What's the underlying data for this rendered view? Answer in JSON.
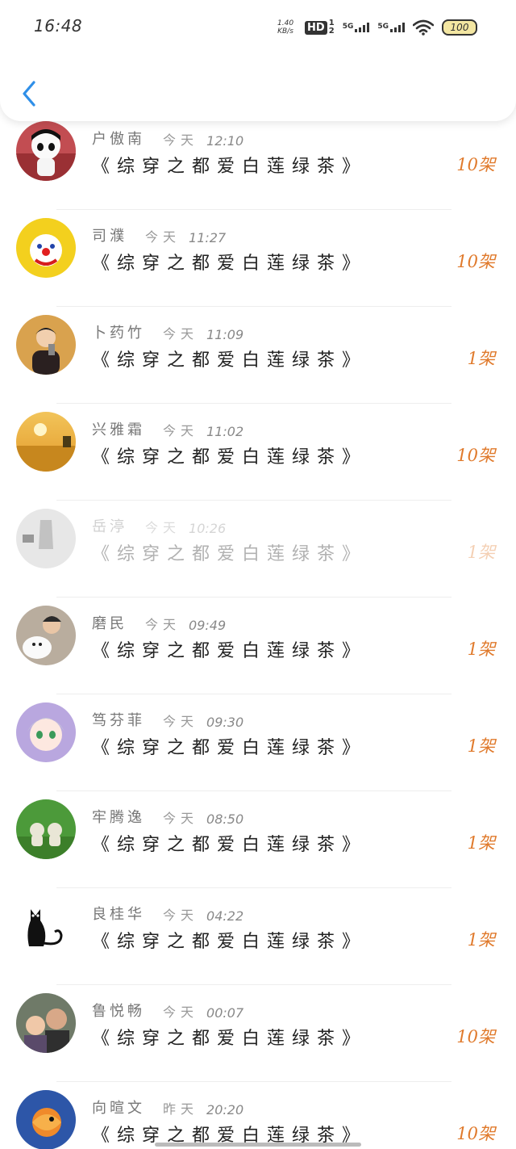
{
  "status_bar": {
    "time": "16:48",
    "net_speed_value": "1.40",
    "net_speed_unit": "KB/s",
    "hd_label": "HD",
    "hd_sub_top": "1",
    "hd_sub_bottom": "2",
    "signal_1": "5G",
    "signal_2": "5G",
    "battery": "100"
  },
  "header": {
    "back_icon": "chevron-left-icon",
    "accent": "#2f8fe8"
  },
  "colors": {
    "gift_orange": "#e07a2c"
  },
  "items": [
    {
      "name": "户傲南",
      "day": "今天",
      "time": "12:10",
      "title": "《综穿之都爱白莲绿茶》",
      "gift": "10架",
      "faded": false
    },
    {
      "name": "司濮",
      "day": "今天",
      "time": "11:27",
      "title": "《综穿之都爱白莲绿茶》",
      "gift": "10架",
      "faded": false
    },
    {
      "name": "卜药竹",
      "day": "今天",
      "time": "11:09",
      "title": "《综穿之都爱白莲绿茶》",
      "gift": "1架",
      "faded": false
    },
    {
      "name": "兴雅霜",
      "day": "今天",
      "time": "11:02",
      "title": "《综穿之都爱白莲绿茶》",
      "gift": "10架",
      "faded": false
    },
    {
      "name": "岳渟",
      "day": "今天",
      "time": "10:26",
      "title": "《综穿之都爱白莲绿茶》",
      "gift": "1架",
      "faded": true
    },
    {
      "name": "磨民",
      "day": "今天",
      "time": "09:49",
      "title": "《综穿之都爱白莲绿茶》",
      "gift": "1架",
      "faded": false
    },
    {
      "name": "笃芬菲",
      "day": "今天",
      "time": "09:30",
      "title": "《综穿之都爱白莲绿茶》",
      "gift": "1架",
      "faded": false
    },
    {
      "name": "牢腾逸",
      "day": "今天",
      "time": "08:50",
      "title": "《综穿之都爱白莲绿茶》",
      "gift": "1架",
      "faded": false
    },
    {
      "name": "良桂华",
      "day": "今天",
      "time": "04:22",
      "title": "《综穿之都爱白莲绿茶》",
      "gift": "1架",
      "faded": false
    },
    {
      "name": "鲁悦畅",
      "day": "今天",
      "time": "00:07",
      "title": "《综穿之都爱白莲绿茶》",
      "gift": "10架",
      "faded": false
    },
    {
      "name": "向暄文",
      "day": "昨天",
      "time": "20:20",
      "title": "《综穿之都爱白莲绿茶》",
      "gift": "10架",
      "faded": false
    }
  ]
}
